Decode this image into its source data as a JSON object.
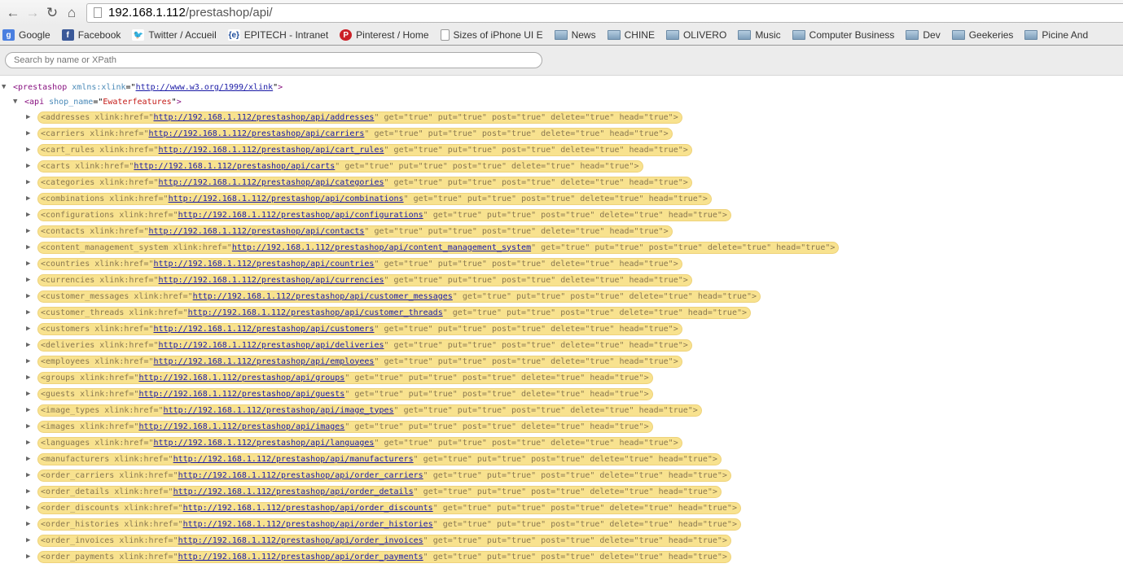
{
  "browser": {
    "url_host": "192.168.1.112",
    "url_path": "/prestashop/api/",
    "bookmarks": [
      {
        "label": "Google",
        "icon": "google-icon"
      },
      {
        "label": "Facebook",
        "icon": "facebook-icon"
      },
      {
        "label": "Twitter / Accueil",
        "icon": "twitter-icon"
      },
      {
        "label": "EPITECH - Intranet",
        "icon": "epitech-icon"
      },
      {
        "label": "Pinterest / Home",
        "icon": "pinterest-icon"
      },
      {
        "label": "Sizes of iPhone UI E",
        "icon": "page-icon"
      }
    ],
    "folders": [
      "News",
      "CHINE",
      "OLIVERO",
      "Music",
      "Computer Business",
      "Dev",
      "Geekeries",
      "Picine And"
    ]
  },
  "search": {
    "placeholder": "Search by name or XPath"
  },
  "xml": {
    "root_tag": "prestashop",
    "root_attr": "xmlns:xlink",
    "root_value": "http://www.w3.org/1999/xlink",
    "api_tag": "api",
    "api_attr": "shop_name",
    "api_value": "Ewaterfeatures",
    "base_url": "http://192.168.1.112/prestashop/api/",
    "permissions": " get=\"true\" put=\"true\" post=\"true\" delete=\"true\" head=\"true\">",
    "resources": [
      "addresses",
      "carriers",
      "cart_rules",
      "carts",
      "categories",
      "combinations",
      "configurations",
      "contacts",
      "content_management_system",
      "countries",
      "currencies",
      "customer_messages",
      "customer_threads",
      "customers",
      "deliveries",
      "employees",
      "groups",
      "guests",
      "image_types",
      "images",
      "languages",
      "manufacturers",
      "order_carriers",
      "order_details",
      "order_discounts",
      "order_histories",
      "order_invoices",
      "order_payments"
    ]
  },
  "colors": {
    "highlight": "#f8e28f",
    "tag": "#881280",
    "attr_value": "#c41a16",
    "link": "#1a1aa6"
  }
}
